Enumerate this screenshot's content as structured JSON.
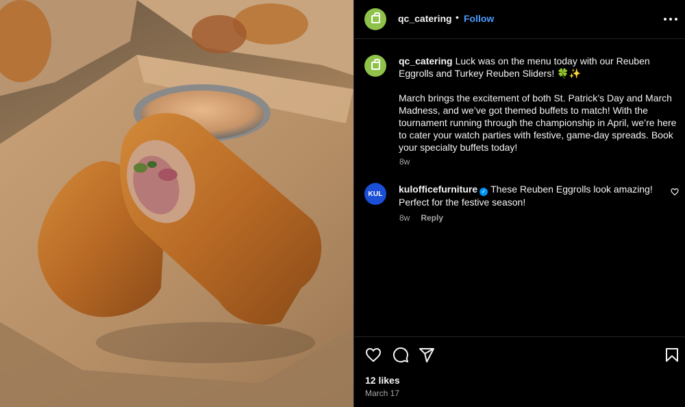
{
  "post": {
    "username": "qc_catering",
    "separator": "•",
    "follow_label": "Follow",
    "more_icon": "more-horizontal-icon",
    "avatar_color": "#8fc24a",
    "caption_line1": "Luck was on the menu today with our Reuben Eggrolls and Turkey Reuben Sliders! 🍀✨",
    "caption_line2": "March brings the excitement of both St. Patrick’s Day and March Madness, and we’ve got themed buffets to match! With the tournament running through the championship in April, we’re here to cater your watch parties with festive, game-day spreads. Book your specialty buffets today!",
    "caption_age": "8w"
  },
  "comment": {
    "username": "kulofficefurniture",
    "avatar_text": "KUL",
    "verified_icon": "verified-badge-icon",
    "text": "These Reuben Eggrolls look amazing! Perfect for the festive season!",
    "age": "8w",
    "reply_label": "Reply"
  },
  "actions": {
    "like_icon": "heart-icon",
    "comment_icon": "comment-icon",
    "share_icon": "send-icon",
    "save_icon": "bookmark-icon",
    "likes_label": "12 likes",
    "date": "March 17"
  },
  "colors": {
    "link_blue": "#4c9dff",
    "muted": "#a8a8a8",
    "background": "#000000"
  }
}
